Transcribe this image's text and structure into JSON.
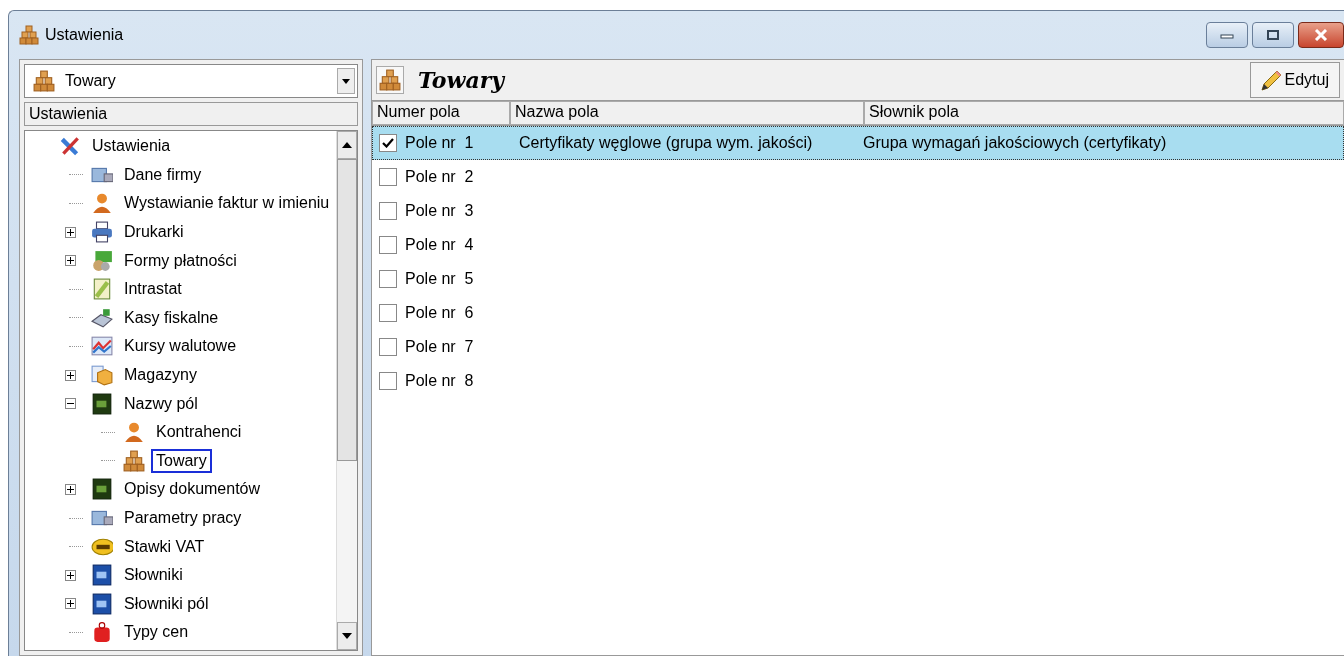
{
  "window": {
    "title": "Ustawienia"
  },
  "left": {
    "combo": {
      "value": "Towary"
    },
    "header": "Ustawienia",
    "tree": [
      {
        "label": "Ustawienia",
        "kind": "tools",
        "selected": false,
        "children": [
          {
            "label": "Dane firmy",
            "kind": "building",
            "selected": false
          },
          {
            "label": "Wystawianie faktur w imieniu",
            "kind": "person",
            "selected": false
          },
          {
            "label": "Drukarki",
            "kind": "printer",
            "expanded": false,
            "selected": false
          },
          {
            "label": "Formy płatności",
            "kind": "money",
            "expanded": false,
            "selected": false
          },
          {
            "label": "Intrastat",
            "kind": "document",
            "selected": false
          },
          {
            "label": "Kasy fiskalne",
            "kind": "register",
            "selected": false
          },
          {
            "label": "Kursy walutowe",
            "kind": "chart",
            "selected": false
          },
          {
            "label": "Magazyny",
            "kind": "box",
            "expanded": false,
            "selected": false
          },
          {
            "label": "Nazwy pól",
            "kind": "book-green",
            "expanded": true,
            "selected": false,
            "children": [
              {
                "label": "Kontrahenci",
                "kind": "person",
                "selected": false
              },
              {
                "label": "Towary",
                "kind": "goods",
                "selected": true
              }
            ]
          },
          {
            "label": "Opisy dokumentów",
            "kind": "book-green",
            "expanded": false,
            "selected": false
          },
          {
            "label": "Parametry pracy",
            "kind": "building",
            "selected": false
          },
          {
            "label": "Stawki VAT",
            "kind": "vat",
            "selected": false
          },
          {
            "label": "Słowniki",
            "kind": "book-blue",
            "expanded": false,
            "selected": false
          },
          {
            "label": "Słowniki pól",
            "kind": "book-blue",
            "expanded": false,
            "selected": false
          },
          {
            "label": "Typy cen",
            "kind": "tag",
            "selected": false
          }
        ]
      }
    ]
  },
  "right": {
    "title": "Towary",
    "edit_button": "Edytuj",
    "table": {
      "columns": [
        "Numer pola",
        "Nazwa pola",
        "Słownik pola"
      ],
      "rows": [
        {
          "number": "Pole nr  1",
          "name": "Certyfikaty węglowe (grupa wym. jakości)",
          "dictionary": "Grupa wymagań jakościowych (certyfikaty)",
          "checked": true,
          "selected": true
        },
        {
          "number": "Pole nr  2",
          "checked": false,
          "selected": false
        },
        {
          "number": "Pole nr  3",
          "checked": false,
          "selected": false
        },
        {
          "number": "Pole nr  4",
          "checked": false,
          "selected": false
        },
        {
          "number": "Pole nr  5",
          "checked": false,
          "selected": false
        },
        {
          "number": "Pole nr  6",
          "checked": false,
          "selected": false
        },
        {
          "number": "Pole nr  7",
          "checked": false,
          "selected": false
        },
        {
          "number": "Pole nr  8",
          "checked": false,
          "selected": false
        }
      ]
    }
  }
}
